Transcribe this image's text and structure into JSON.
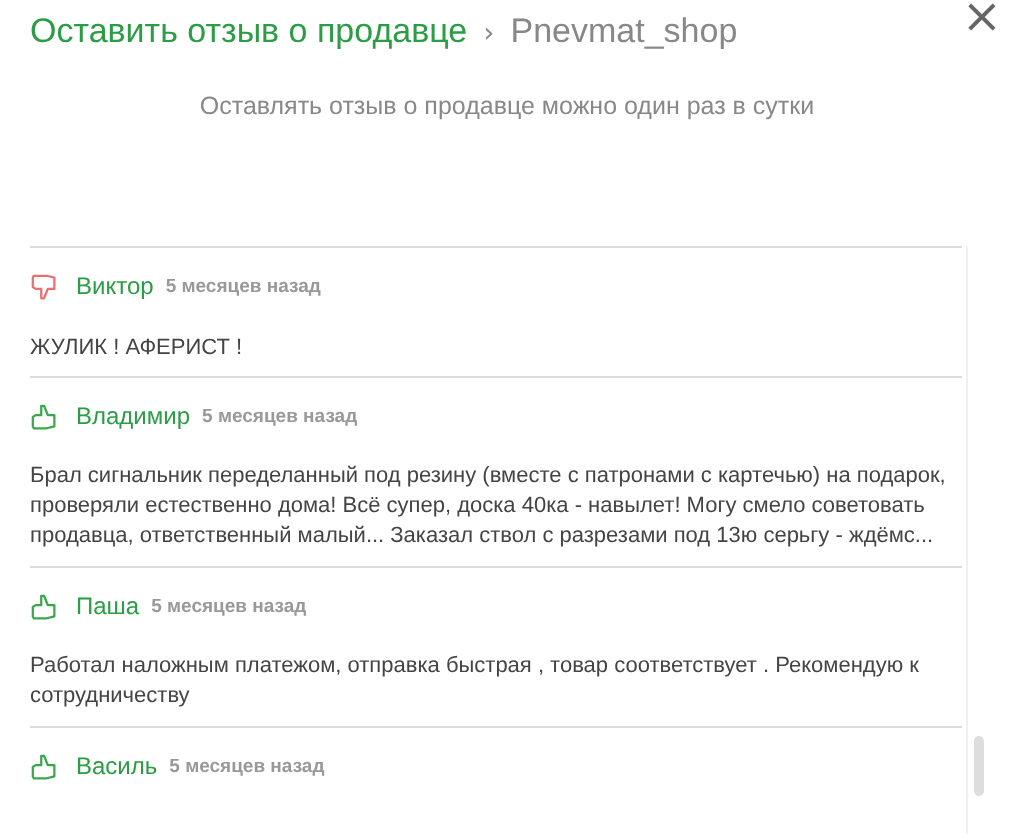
{
  "breadcrumb": {
    "link": "Оставить отзыв о продавце",
    "separator": "›",
    "current": "Pnevmat_shop"
  },
  "close": "×",
  "notice": "Оставлять отзыв о продавце можно один раз в сутки",
  "reviews": [
    {
      "positive": false,
      "author": "Виктор",
      "time": "5 месяцев назад",
      "text": "ЖУЛИК ! АФЕРИСТ !"
    },
    {
      "positive": true,
      "author": "Владимир",
      "time": "5 месяцев назад",
      "text": "Брал сигнальник переделанный под резину (вместе с патронами с картечью) на подарок, проверяли естественно дома! Всё супер, доска 40ка - навылет! Могу смело советовать продавца, ответственный малый... Заказал ствол с разрезами под 13ю серьгу - ждёмс..."
    },
    {
      "positive": true,
      "author": "Паша",
      "time": "5 месяцев назад",
      "text": "Работал наложным платежом, отправка быстрая , товар соответствует . Рекомендую к сотрудничеству"
    },
    {
      "positive": true,
      "author": "Василь",
      "time": "5 месяцев назад"
    }
  ]
}
